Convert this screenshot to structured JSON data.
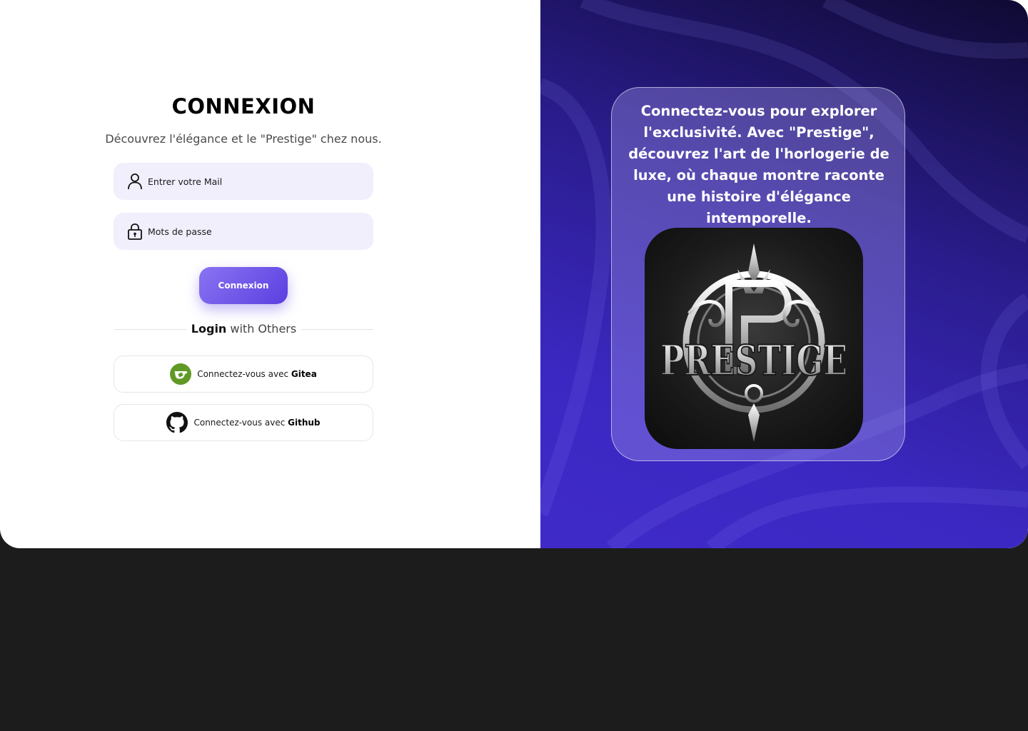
{
  "login": {
    "title": "CONNEXION",
    "subtitle": "Découvrez l'élégance et le \"Prestige\" chez nous.",
    "email_placeholder": "Entrer votre Mail",
    "password_placeholder": "Mots de passe",
    "submit_label": "Connexion",
    "divider_bold": "Login",
    "divider_rest": " with Others",
    "social": [
      {
        "prefix": "Connectez-vous avec ",
        "provider": "Gitea",
        "icon": "gitea-icon"
      },
      {
        "prefix": "Connectez-vous avec ",
        "provider": "Github",
        "icon": "github-icon"
      }
    ]
  },
  "promo": {
    "text": "Connectez-vous pour explorer l'exclusivité. Avec \"Prestige\", découvrez l'art de l'horlogerie de luxe, où chaque montre raconte une histoire d'élégance intemporelle.",
    "logo_text": "PRESTIGE"
  },
  "colors": {
    "accent": "#5b3fe0",
    "field_bg": "#f1effc",
    "gitea_green": "#609926",
    "background": "#1c1c1c"
  },
  "icons": {
    "email": "user-icon",
    "password": "lock-icon"
  }
}
